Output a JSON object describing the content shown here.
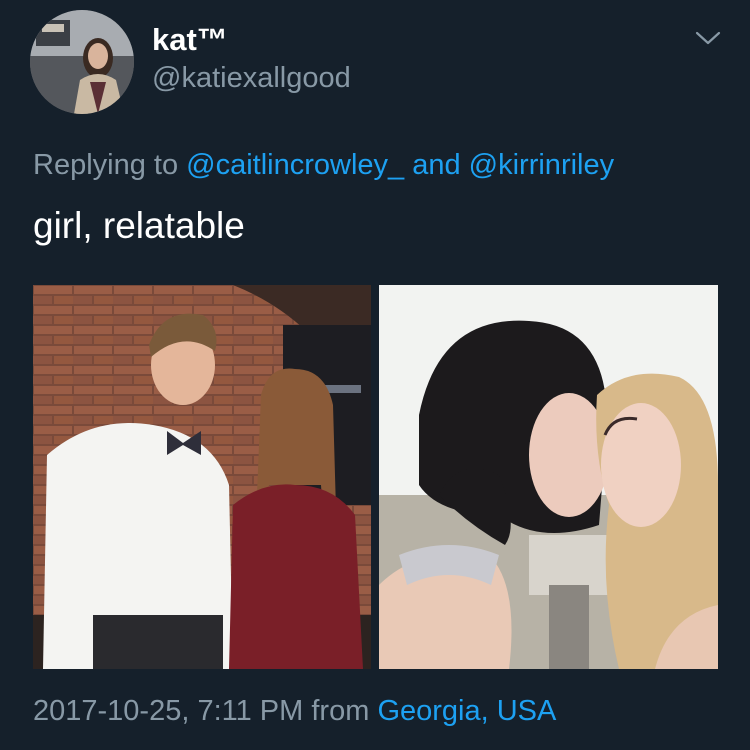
{
  "user": {
    "display_name": "kat™",
    "handle": "@katiexallgood",
    "avatar_icon": "profile-photo"
  },
  "reply": {
    "prefix": "Replying to ",
    "mention_1": "@caitlincrowley_",
    "joiner": " and ",
    "mention_2": "@kirrinriley"
  },
  "tweet": {
    "text": "girl, relatable"
  },
  "media": [
    {
      "icon": "photo",
      "description_hidden": true
    },
    {
      "icon": "photo",
      "description_hidden": true
    }
  ],
  "meta": {
    "timestamp": "2017-10-25, 7:11 PM",
    "from_label": " from ",
    "location": "Georgia, USA"
  },
  "colors": {
    "background": "#15202b",
    "primary_text": "#ffffff",
    "secondary_text": "#8899a6",
    "link": "#1da1f2"
  }
}
